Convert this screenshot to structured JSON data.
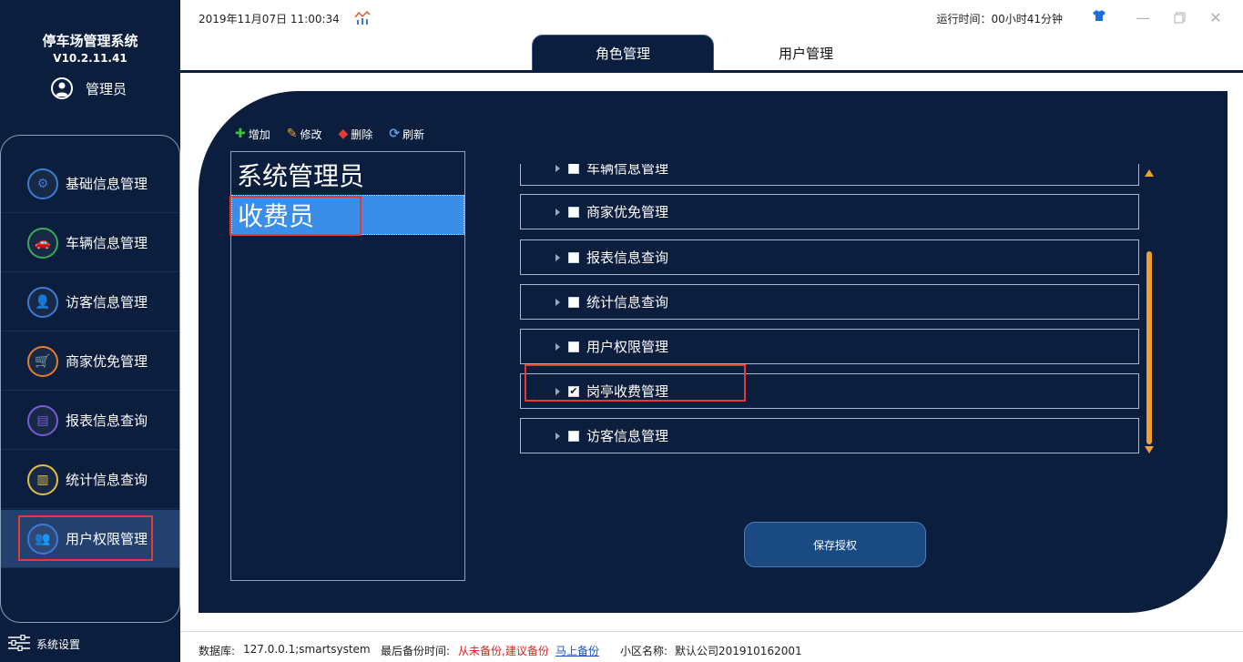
{
  "app": {
    "title": "停车场管理系统",
    "version": "V10.2.11.41",
    "user": "管理员"
  },
  "sidebar": {
    "items": [
      {
        "label": "基础信息管理",
        "icon": "gear-icon",
        "color": "#3a7bd5"
      },
      {
        "label": "车辆信息管理",
        "icon": "car-icon",
        "color": "#3aa85a"
      },
      {
        "label": "访客信息管理",
        "icon": "visitor-icon",
        "color": "#3a7bd5"
      },
      {
        "label": "商家优免管理",
        "icon": "cart-icon",
        "color": "#e57c2e"
      },
      {
        "label": "报表信息查询",
        "icon": "report-icon",
        "color": "#7a5ad5"
      },
      {
        "label": "统计信息查询",
        "icon": "stats-icon",
        "color": "#e0c040"
      },
      {
        "label": "用户权限管理",
        "icon": "users-icon",
        "color": "#3a7bd5"
      }
    ],
    "active_index": 6,
    "settings_label": "系统设置"
  },
  "topbar": {
    "datetime": "2019年11月07日 11:00:34",
    "runtime": "运行时间：00小时41分钟"
  },
  "tabs": [
    {
      "label": "角色管理",
      "active": true
    },
    {
      "label": "用户管理",
      "active": false
    }
  ],
  "toolbar": {
    "add": "增加",
    "edit": "修改",
    "delete": "删除",
    "refresh": "刷新"
  },
  "roles": [
    {
      "label": "系统管理员",
      "selected": false
    },
    {
      "label": "收费员",
      "selected": true
    }
  ],
  "permissions": [
    {
      "label": "车辆信息管理",
      "checked": false
    },
    {
      "label": "商家优免管理",
      "checked": false
    },
    {
      "label": "报表信息查询",
      "checked": false
    },
    {
      "label": "统计信息查询",
      "checked": false
    },
    {
      "label": "用户权限管理",
      "checked": false
    },
    {
      "label": "岗亭收费管理",
      "checked": true
    },
    {
      "label": "访客信息管理",
      "checked": false
    }
  ],
  "save_label": "保存授权",
  "status": {
    "db_label": "数据库:",
    "db_value": "127.0.0.1;smartsystem",
    "backup_label": "最后备份时间:",
    "backup_value": "从未备份,建议备份",
    "backup_link": "马上备份",
    "community_label": "小区名称:",
    "community_value": "默认公司201910162001"
  },
  "colors": {
    "sidebar_bg": "#0c1e3d",
    "accent_orange": "#f0a030",
    "selected_blue": "#3a8ee8",
    "highlight_red": "#e53935"
  }
}
